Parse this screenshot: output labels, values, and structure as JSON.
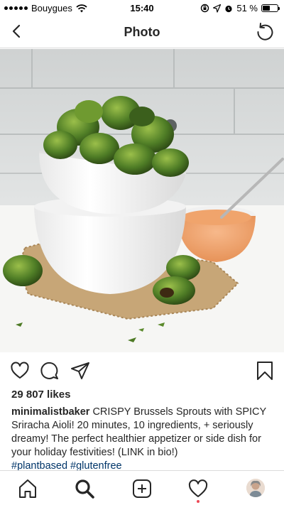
{
  "status_bar": {
    "carrier": "Bouygues",
    "time": "15:40",
    "battery_percent": "51 %",
    "battery_level": 0.51
  },
  "header": {
    "title": "Photo"
  },
  "post": {
    "likes": "29 807 likes",
    "caption": {
      "username": "minimalistbaker",
      "text": "CRISPY Brussels Sprouts with SPICY Sriracha Aioli! 20 minutes, 10 ingredients, + seriously dreamy! The perfect healthier appetizer or side dish for your holiday festivities! (LINK in bio!)",
      "hashtags": [
        "#plantbased",
        "#glutenfree"
      ]
    }
  },
  "icons": {
    "back": "chevron-left-icon",
    "refresh": "refresh-icon",
    "like": "heart-icon",
    "comment": "comment-icon",
    "share": "send-icon",
    "save": "bookmark-icon",
    "home": "home-icon",
    "search": "search-icon",
    "new_post": "add-post-icon",
    "activity": "heart-icon",
    "profile": "avatar"
  },
  "colors": {
    "text": "#262626",
    "hashtag": "#003569",
    "divider": "#dbdbdb",
    "notification": "#ed4956"
  }
}
